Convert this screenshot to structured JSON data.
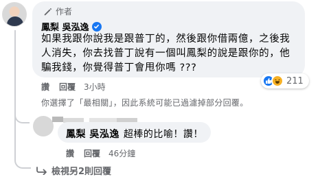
{
  "comment": {
    "author_badge": "作者",
    "author_name": "鳳梨 吳泓逸",
    "text": "如果我跟你說我是跟普丁的，然後跟你借兩億，之後我人消失，你去找普丁說有一個叫鳳梨的說是跟你的，他騙我錢，你覺得普丁會甩你嗎 ???",
    "reaction_count": "211",
    "like_label": "讚",
    "reply_label": "回覆",
    "time": "3小時"
  },
  "notice": "你選擇了「最相關」，因此系統可能已過濾掉部分回覆。",
  "reply": {
    "tag": "鳳梨 吳泓逸",
    "text": "超棒的比喻！讚！",
    "like_label": "讚",
    "reply_label": "回覆",
    "time": "46分鐘"
  },
  "more_replies": "檢視另2則回覆",
  "colors": {
    "facebook_blue": "#1877f2",
    "haha_yellow": "#f7b125",
    "secondary_text": "#65676b",
    "bubble_bg": "#f0f2f5"
  }
}
